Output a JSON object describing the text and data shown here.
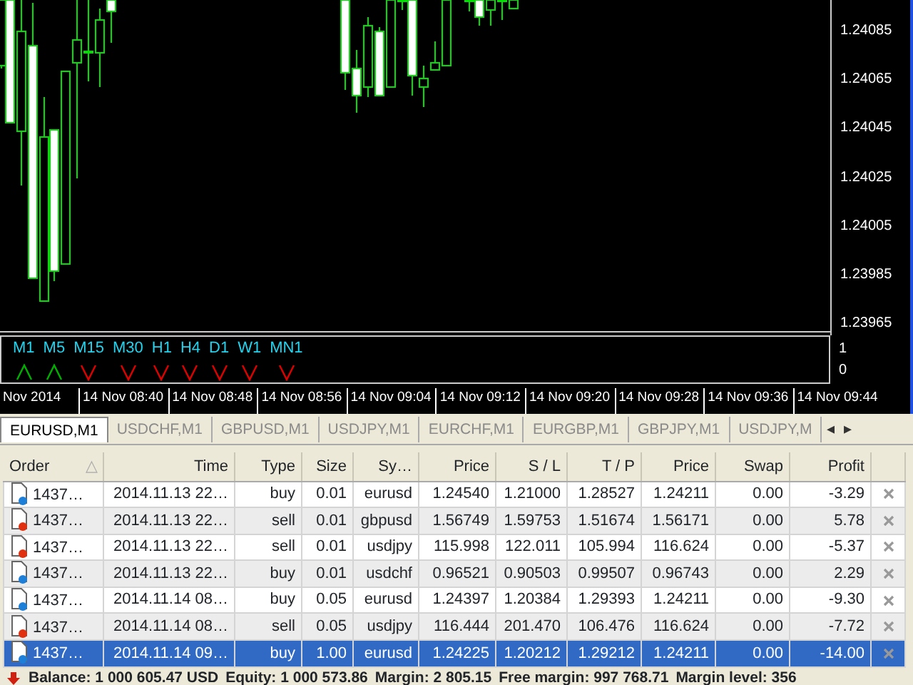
{
  "chart": {
    "price_ticks": [
      "1.24085",
      "1.24065",
      "1.24045",
      "1.24025",
      "1.24005",
      "1.23985",
      "1.23965"
    ],
    "time_ticks": [
      "Nov 2014",
      "14 Nov 08:40",
      "14 Nov 08:48",
      "14 Nov 08:56",
      "14 Nov 09:04",
      "14 Nov 09:12",
      "14 Nov 09:20",
      "14 Nov 09:28",
      "14 Nov 09:36",
      "14 Nov 09:44"
    ]
  },
  "indicator": {
    "timeframes": [
      {
        "label": "M1",
        "kind": "up"
      },
      {
        "label": "M5",
        "kind": "up"
      },
      {
        "label": "M15",
        "kind": "down"
      },
      {
        "label": "M30",
        "kind": "down"
      },
      {
        "label": "H1",
        "kind": "down"
      },
      {
        "label": "H4",
        "kind": "down"
      },
      {
        "label": "D1",
        "kind": "down"
      },
      {
        "label": "W1",
        "kind": "down"
      },
      {
        "label": "MN1",
        "kind": "down"
      }
    ],
    "scale": [
      "1",
      "0"
    ]
  },
  "chart_tabs": [
    {
      "label": "EURUSD,M1",
      "selected": true
    },
    {
      "label": "USDCHF,M1",
      "selected": false
    },
    {
      "label": "GBPUSD,M1",
      "selected": false
    },
    {
      "label": "USDJPY,M1",
      "selected": false
    },
    {
      "label": "EURCHF,M1",
      "selected": false
    },
    {
      "label": "EURGBP,M1",
      "selected": false
    },
    {
      "label": "GBPJPY,M1",
      "selected": false
    },
    {
      "label": "USDJPY,M",
      "selected": false
    }
  ],
  "tab_scroll": [
    "◂",
    "▸"
  ],
  "table": {
    "columns": [
      "Order",
      "Time",
      "Type",
      "Size",
      "Sy…",
      "Price",
      "S / L",
      "T / P",
      "Price",
      "Swap",
      "Profit"
    ],
    "sort_mark": "△",
    "rows": [
      {
        "cells": [
          "1437…",
          "2014.11.13 22…",
          "buy",
          "0.01",
          "eurusd",
          "1.24540",
          "1.21000",
          "1.28527",
          "1.24211",
          "0.00",
          "-3.29"
        ],
        "color": "#1e7fd8",
        "selected": false
      },
      {
        "cells": [
          "1437…",
          "2014.11.13 22…",
          "sell",
          "0.01",
          "gbpusd",
          "1.56749",
          "1.59753",
          "1.51674",
          "1.56171",
          "0.00",
          "5.78"
        ],
        "color": "#e03010",
        "selected": false
      },
      {
        "cells": [
          "1437…",
          "2014.11.13 22…",
          "sell",
          "0.01",
          "usdjpy",
          "115.998",
          "122.011",
          "105.994",
          "116.624",
          "0.00",
          "-5.37"
        ],
        "color": "#e03010",
        "selected": false
      },
      {
        "cells": [
          "1437…",
          "2014.11.13 22…",
          "buy",
          "0.01",
          "usdchf",
          "0.96521",
          "0.90503",
          "0.99507",
          "0.96743",
          "0.00",
          "2.29"
        ],
        "color": "#1e7fd8",
        "selected": false
      },
      {
        "cells": [
          "1437…",
          "2014.11.14 08…",
          "buy",
          "0.05",
          "eurusd",
          "1.24397",
          "1.20384",
          "1.29393",
          "1.24211",
          "0.00",
          "-9.30"
        ],
        "color": "#1e7fd8",
        "selected": false
      },
      {
        "cells": [
          "1437…",
          "2014.11.14 08…",
          "sell",
          "0.05",
          "usdjpy",
          "116.444",
          "201.470",
          "106.476",
          "116.624",
          "0.00",
          "-7.72"
        ],
        "color": "#e03010",
        "selected": false
      },
      {
        "cells": [
          "1437…",
          "2014.11.14 09…",
          "buy",
          "1.00",
          "eurusd",
          "1.24225",
          "1.20212",
          "1.29212",
          "1.24211",
          "0.00",
          "-14.00"
        ],
        "color": "#1e7fd8",
        "selected": true
      }
    ]
  },
  "status_bar": [
    "Balance: 1 000 605.47 USD",
    "Equity: 1 000 573.86",
    "Margin: 2 805.15",
    "Free margin: 997 768.71",
    "Margin level: 356"
  ]
}
